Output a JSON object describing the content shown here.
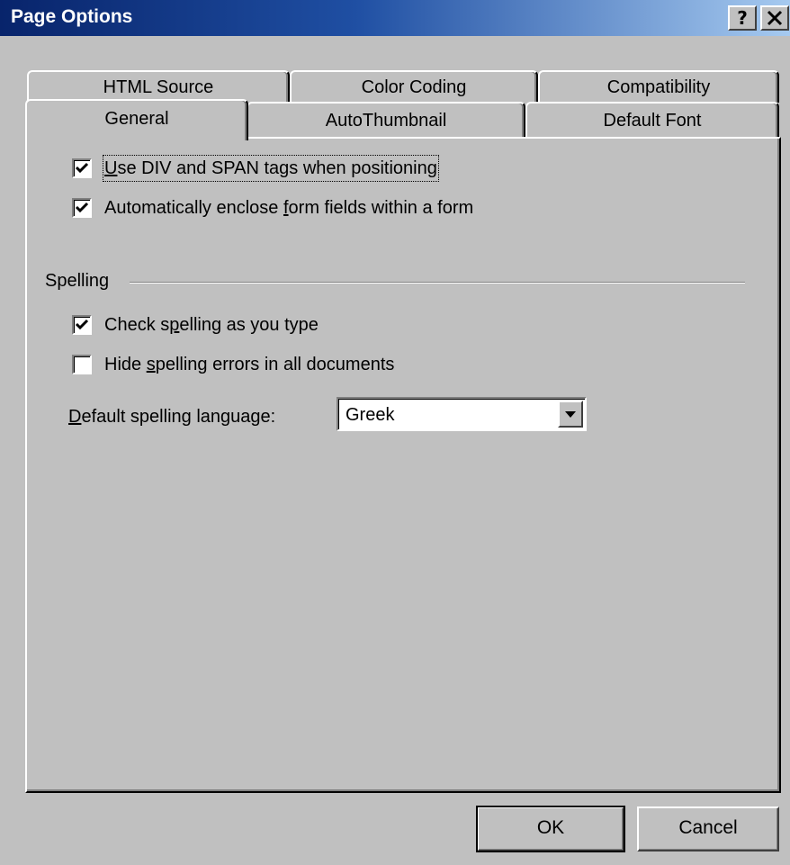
{
  "window": {
    "title": "Page Options",
    "help_label": "?",
    "close_label": "×"
  },
  "tabs": {
    "html_source": "HTML Source",
    "color_coding": "Color Coding",
    "compatibility": "Compatibility",
    "general": "General",
    "autothumbnail": "AutoThumbnail",
    "default_font": "Default Font",
    "active": "General"
  },
  "general": {
    "options": [
      {
        "pre": "",
        "key": "U",
        "post": "se DIV and SPAN tags when positioning",
        "checked": true
      },
      {
        "pre": "Automatically enclose ",
        "key": "f",
        "post": "orm fields within a form",
        "checked": true
      }
    ]
  },
  "spelling": {
    "section_title": "Spelling",
    "options": [
      {
        "pre": "Check s",
        "key": "p",
        "post": "elling as you type",
        "checked": true
      },
      {
        "pre": "Hide ",
        "key": "s",
        "post": "pelling errors in all documents",
        "checked": false
      }
    ],
    "language_label_key": "D",
    "language_label_rest": "efault spelling language:",
    "language_value": "Greek"
  },
  "buttons": {
    "ok": "OK",
    "cancel": "Cancel"
  }
}
